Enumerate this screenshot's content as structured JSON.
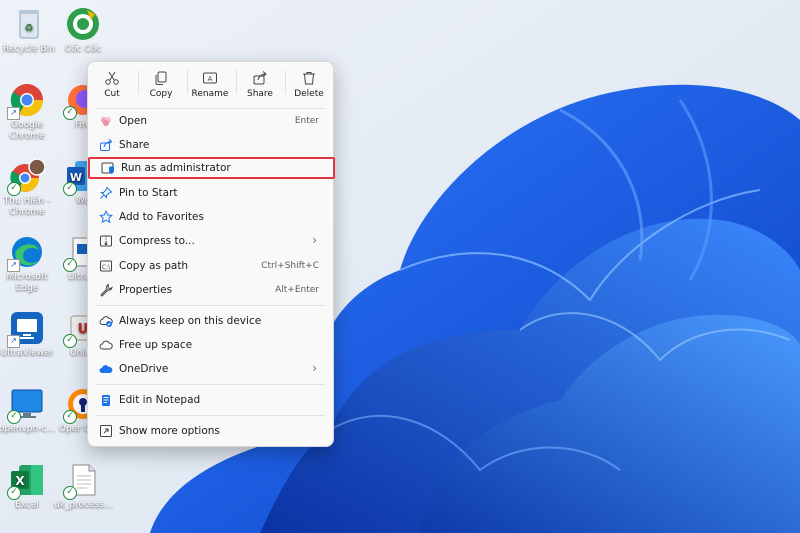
{
  "desktop": {
    "icons": [
      {
        "label": "Recycle Bin",
        "icon": "recycle-bin-icon"
      },
      {
        "label": "Cốc Cốc",
        "icon": "coccoc-icon"
      },
      {
        "label": "Google Chrome",
        "icon": "chrome-icon"
      },
      {
        "label": "Fire",
        "icon": "firefox-icon"
      },
      {
        "label": "Thu Hiền - Chrome",
        "icon": "chrome-profile-icon"
      },
      {
        "label": "Wo",
        "icon": "word-icon"
      },
      {
        "label": "Microsoft Edge",
        "icon": "edge-icon"
      },
      {
        "label": "UltraVi",
        "icon": "ultraviewer-file-icon"
      },
      {
        "label": "UltraViewer",
        "icon": "ultraviewer-icon"
      },
      {
        "label": "UniKe",
        "icon": "unikey-icon"
      },
      {
        "label": "openvpn-c...",
        "icon": "openvpn-icon"
      },
      {
        "label": "Oper Conn",
        "icon": "openvpn-connect-icon"
      },
      {
        "label": "Excel",
        "icon": "excel-icon"
      },
      {
        "label": "uk_process...",
        "icon": "text-file-icon"
      }
    ]
  },
  "toolbar": {
    "cut": "Cut",
    "copy": "Copy",
    "rename": "Rename",
    "share": "Share",
    "delete": "Delete"
  },
  "menu": {
    "open": {
      "label": "Open",
      "shortcut": "Enter"
    },
    "share": {
      "label": "Share"
    },
    "run_admin": {
      "label": "Run as administrator"
    },
    "pin_start": {
      "label": "Pin to Start"
    },
    "favorites": {
      "label": "Add to Favorites"
    },
    "compress": {
      "label": "Compress to...",
      "chevron": "›"
    },
    "copy_path": {
      "label": "Copy as path",
      "shortcut": "Ctrl+Shift+C"
    },
    "properties": {
      "label": "Properties",
      "shortcut": "Alt+Enter"
    },
    "keep_device": {
      "label": "Always keep on this device"
    },
    "free_space": {
      "label": "Free up space"
    },
    "onedrive": {
      "label": "OneDrive",
      "chevron": "›"
    },
    "notepad": {
      "label": "Edit in Notepad"
    },
    "more_options": {
      "label": "Show more options"
    }
  },
  "colors": {
    "accent": "#1a73e8",
    "highlight_border": "#e0353b",
    "wallpaper_blue": "#1e5ee6"
  }
}
